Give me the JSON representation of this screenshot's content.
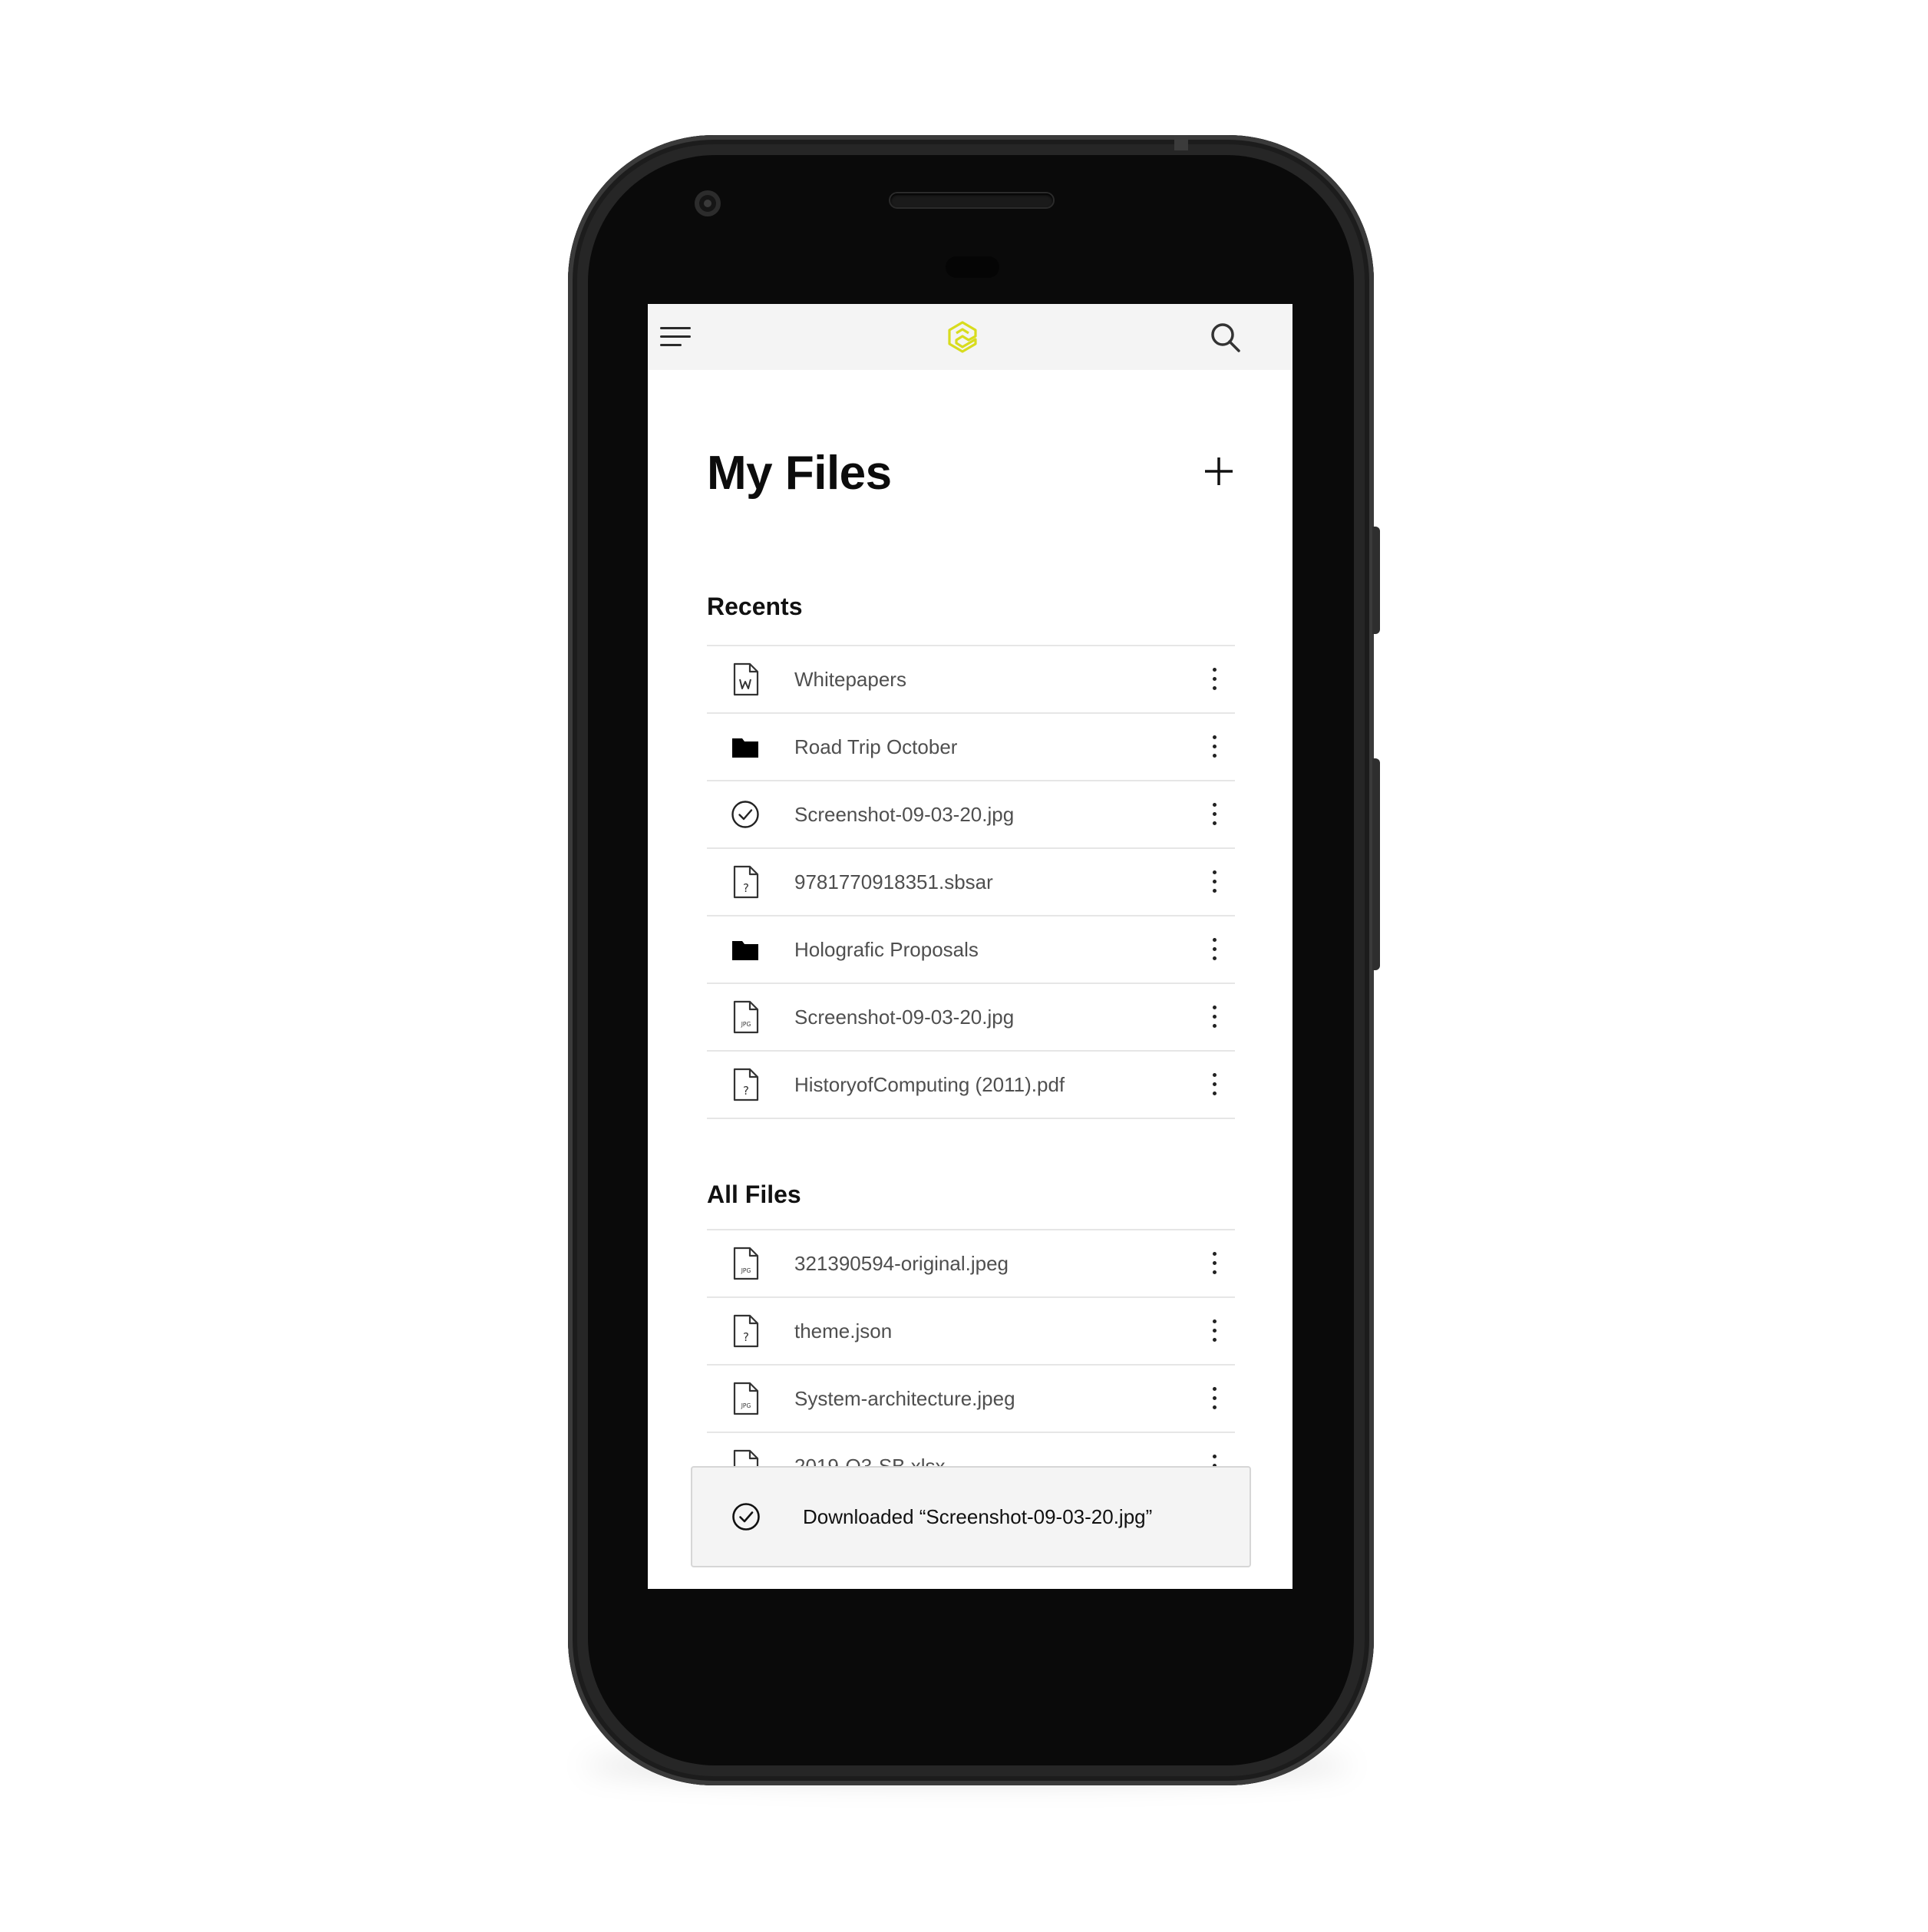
{
  "app": {
    "logo_icon": "app-logo-icon",
    "logo_color": "#d8dc1e",
    "menu_icon": "hamburger-menu-icon",
    "search_icon": "search-icon",
    "add_icon": "plus-icon"
  },
  "page": {
    "title": "My Files"
  },
  "recents": {
    "title": "Recents",
    "items": [
      {
        "name": "Whitepapers",
        "icon": "word-document-icon"
      },
      {
        "name": "Road Trip October",
        "icon": "folder-icon"
      },
      {
        "name": "Screenshot-09-03-20.jpg",
        "icon": "check-circle-icon"
      },
      {
        "name": "9781770918351.sbsar",
        "icon": "unknown-file-icon"
      },
      {
        "name": "Holografic Proposals",
        "icon": "folder-icon"
      },
      {
        "name": "Screenshot-09-03-20.jpg",
        "icon": "jpg-file-icon"
      },
      {
        "name": "HistoryofComputing (2011).pdf",
        "icon": "unknown-file-icon"
      }
    ]
  },
  "all_files": {
    "title": "All Files",
    "items": [
      {
        "name": "321390594-original.jpeg",
        "icon": "jpg-file-icon"
      },
      {
        "name": "theme.json",
        "icon": "unknown-file-icon"
      },
      {
        "name": "System-architecture.jpeg",
        "icon": "jpg-file-icon"
      },
      {
        "name": "2019-Q3-SB.xlsx",
        "icon": "file-icon"
      }
    ]
  },
  "toast": {
    "icon": "check-circle-icon",
    "message": "Downloaded “Screenshot-09-03-20.jpg”"
  }
}
